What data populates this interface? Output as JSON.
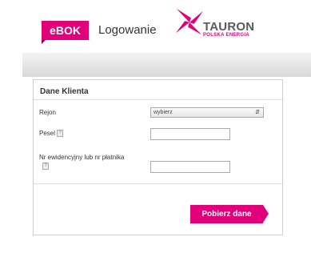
{
  "header": {
    "badge": "eBOK",
    "title": "Logowanie",
    "logo_name": "TAURON",
    "logo_sub": "POLSKA ENERGIA"
  },
  "form": {
    "title": "Dane Klienta",
    "rejon_label": "Rejon",
    "rejon_value": "wybierz",
    "pesel_label": "Pesel",
    "pesel_value": "",
    "nr_label": "Nr ewidencyjny lub nr płatnika",
    "nr_value": "",
    "help_glyph": "?",
    "submit_label": "Pobierz dane"
  },
  "colors": {
    "brand": "#e2007a",
    "logo_text": "#5a5a5a"
  }
}
